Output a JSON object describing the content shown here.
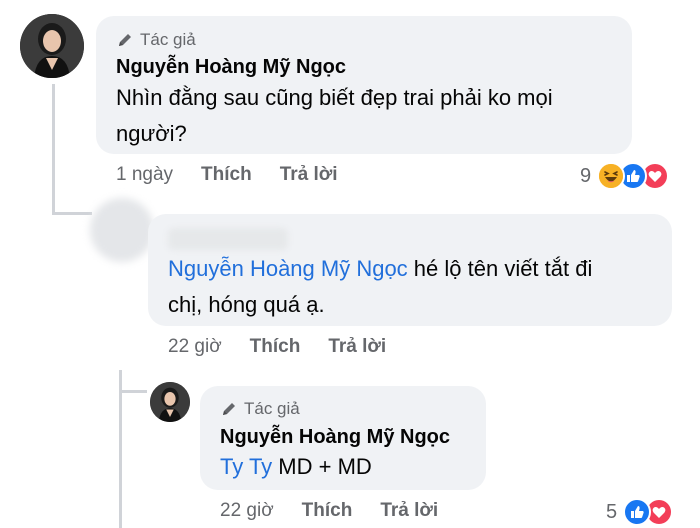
{
  "comment1": {
    "badge_icon": "pencil-icon",
    "badge_label": "Tác giả",
    "author": "Nguyễn Hoàng Mỹ Ngọc",
    "text_line1": "Nhìn đằng sau cũng biết đẹp trai phải ko mọi",
    "text_line2": "người?",
    "time": "1 ngày",
    "like_label": "Thích",
    "reply_label": "Trả lời",
    "reaction_count": "9",
    "reaction_icons": [
      "haha-icon",
      "like-icon",
      "love-icon"
    ]
  },
  "reply1": {
    "mention": "Nguyễn Hoàng Mỹ Ngọc",
    "text_after_mention": " hé lộ tên viết tắt đi",
    "text_line2": "chị, hóng quá ạ.",
    "time": "22 giờ",
    "like_label": "Thích",
    "reply_label": "Trả lời"
  },
  "reply2": {
    "badge_icon": "pencil-icon",
    "badge_label": "Tác giả",
    "author": "Nguyễn Hoàng Mỹ Ngọc",
    "mention": "Ty Ty",
    "text_after_mention": " MD + MD",
    "time": "22 giờ",
    "like_label": "Thích",
    "reply_label": "Trả lời",
    "reaction_count": "5",
    "reaction_icons": [
      "like-icon",
      "love-icon"
    ]
  },
  "colors": {
    "bubble": "#f0f2f5",
    "mention": "#216fdb",
    "meta": "#65676b",
    "like": "#1877f2",
    "love": "#f33e58",
    "haha": "#f7b125"
  }
}
